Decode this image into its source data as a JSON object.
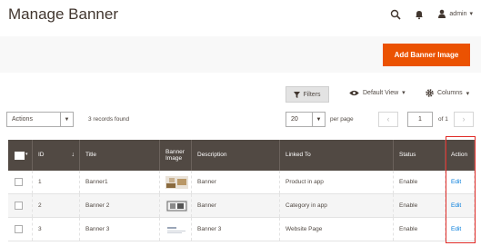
{
  "header": {
    "title": "Manage Banner",
    "user_label": "admin"
  },
  "action_bar": {
    "add_button_label": "Add Banner Image"
  },
  "toolbar": {
    "filters_label": "Filters",
    "view_label": "Default View",
    "columns_label": "Columns",
    "actions_label": "Actions",
    "records_found": "3 records found",
    "per_page_value": "20",
    "per_page_label": "per page",
    "page_current": "1",
    "page_total_label": "of 1"
  },
  "grid": {
    "columns": [
      "ID",
      "Title",
      "Banner Image",
      "Description",
      "Linked To",
      "Status",
      "Action"
    ],
    "rows": [
      {
        "id": "1",
        "title": "Banner1",
        "description": "Banner",
        "linked_to": "Product in app",
        "status": "Enable",
        "action": "Edit"
      },
      {
        "id": "2",
        "title": "Banner 2",
        "description": "Banner",
        "linked_to": "Category in app",
        "status": "Enable",
        "action": "Edit"
      },
      {
        "id": "3",
        "title": "Banner 3",
        "description": "Banner 3",
        "linked_to": "Website Page",
        "status": "Enable",
        "action": "Edit"
      }
    ]
  },
  "colors": {
    "accent": "#eb5202",
    "header_bg": "#514943",
    "link": "#007bdb",
    "highlight": "#e02b27"
  }
}
